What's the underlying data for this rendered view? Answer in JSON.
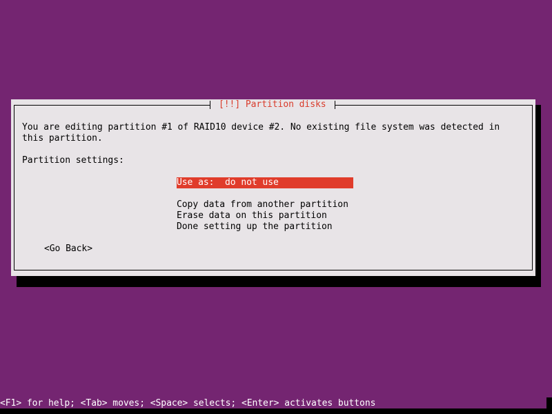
{
  "dialog": {
    "title": "[!!] Partition disks",
    "message": "You are editing partition #1 of RAID10 device #2. No existing file system was detected in\nthis partition.",
    "settings_label": "Partition settings:",
    "menu": [
      {
        "label": "Use as:  do not use",
        "selected": true
      },
      {
        "label": "",
        "spacer": true
      },
      {
        "label": "Copy data from another partition"
      },
      {
        "label": "Erase data on this partition"
      },
      {
        "label": "Done setting up the partition"
      }
    ],
    "go_back_label": "<Go Back>"
  },
  "statusbar": {
    "help_text": "<F1> for help; <Tab> moves; <Space> selects; <Enter> activates buttons"
  },
  "colors": {
    "background": "#742571",
    "dialog_bg": "#e8e4e7",
    "title": "#d93b2b",
    "selection": "#e03c2b"
  }
}
